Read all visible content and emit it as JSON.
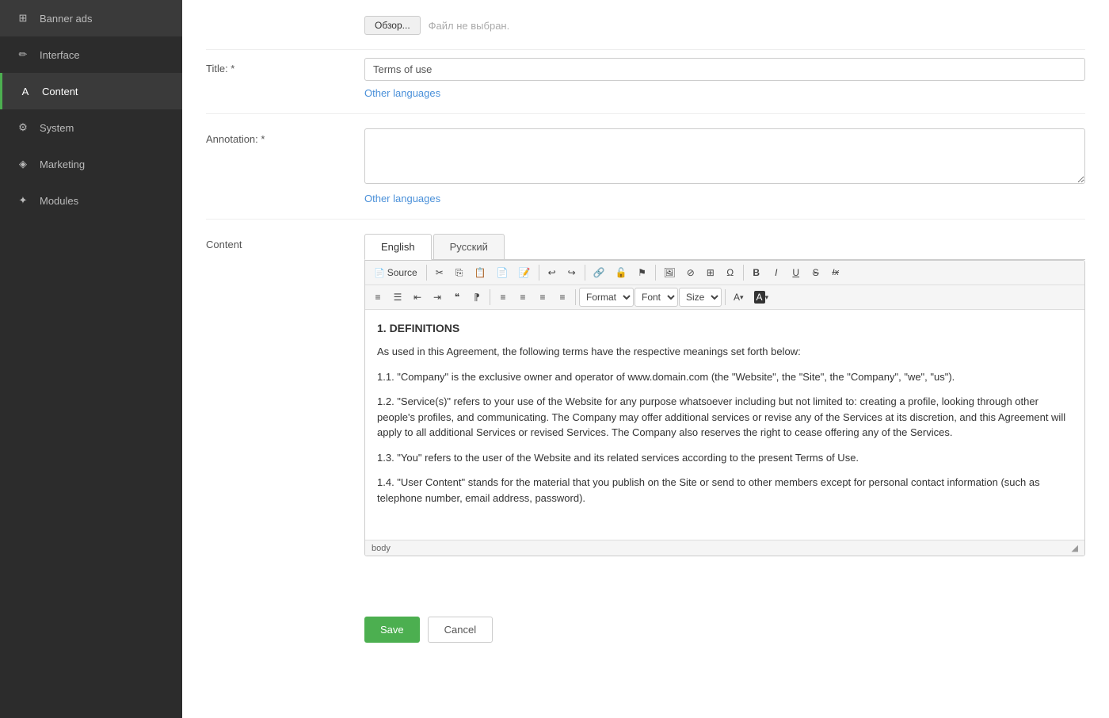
{
  "sidebar": {
    "items": [
      {
        "id": "banner-ads",
        "label": "Banner ads",
        "icon": "⊞"
      },
      {
        "id": "interface",
        "label": "Interface",
        "icon": "✏️"
      },
      {
        "id": "content",
        "label": "Content",
        "icon": "A",
        "active": true
      },
      {
        "id": "system",
        "label": "System",
        "icon": "⚙"
      },
      {
        "id": "marketing",
        "label": "Marketing",
        "icon": "📢"
      },
      {
        "id": "modules",
        "label": "Modules",
        "icon": "🧩"
      }
    ]
  },
  "form": {
    "file_browse": "Обзор...",
    "file_placeholder": "Файл не выбран.",
    "title_label": "Title: *",
    "title_value": "Terms of use",
    "other_languages_1": "Other languages",
    "annotation_label": "Annotation: *",
    "annotation_value": "",
    "other_languages_2": "Other languages",
    "content_label": "Content"
  },
  "tabs": [
    {
      "id": "english",
      "label": "English",
      "active": true
    },
    {
      "id": "russian",
      "label": "Русский",
      "active": false
    }
  ],
  "toolbar": {
    "row1": {
      "source_label": "Source",
      "buttons": [
        "cut",
        "copy",
        "paste",
        "paste-text",
        "paste-word",
        "undo",
        "redo",
        "link",
        "unlink",
        "flag",
        "image",
        "circle",
        "table",
        "omega",
        "bold",
        "italic",
        "underline",
        "strikethrough",
        "clear-format"
      ]
    },
    "row2": {
      "buttons": [
        "ol",
        "ul",
        "indent-left",
        "indent-right",
        "blockquote",
        "special-chars",
        "align-left",
        "align-center",
        "align-right",
        "align-justify"
      ],
      "format_label": "Format",
      "font_label": "Font",
      "size_label": "Size",
      "font_color_label": "A",
      "bg_color_label": "A"
    }
  },
  "editor": {
    "heading": "1. DEFINITIONS",
    "paragraphs": [
      "As used in this Agreement, the following terms have the respective meanings set forth below:",
      "1.1. \"Company\" is the exclusive owner and operator of www.domain.com (the \"Website\", the \"Site\", the \"Company\", \"we\", \"us\").",
      "1.2. \"Service(s)\" refers to your use of the Website for any purpose whatsoever including but not limited to: creating a profile, looking through other people's profiles, and communicating. The Company may offer additional services or revise any of the Services at its discretion, and this Agreement will apply to all additional Services or revised Services. The Company also reserves the right to cease offering any of the Services.",
      "1.3. \"You\" refers to the user of the Website and its related services according to the present Terms of Use.",
      "1.4. \"User Content\" stands for the material that you publish on the Site or send to other members except for personal contact information (such as telephone number, email address, password)."
    ],
    "footer": "body"
  },
  "actions": {
    "save_label": "Save",
    "cancel_label": "Cancel"
  }
}
